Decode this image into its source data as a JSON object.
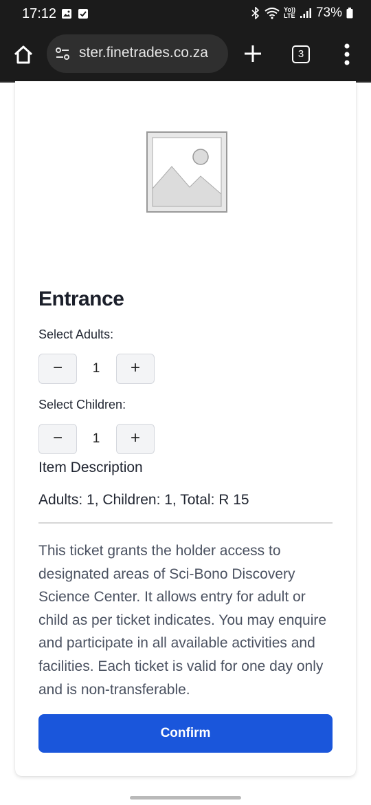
{
  "status_bar": {
    "time": "17:12",
    "battery": "73%",
    "network_label": "Yo))\nLTE",
    "icons": [
      "image-icon",
      "check-icon",
      "bluetooth-icon",
      "wifi-icon",
      "signal-icon",
      "battery-icon"
    ]
  },
  "browser": {
    "url": "ster.finetrades.co.za",
    "tab_count": "3",
    "icons": [
      "home-icon",
      "site-settings-icon",
      "new-tab-icon",
      "tab-switcher-icon",
      "more-menu-icon"
    ]
  },
  "product": {
    "title": "Entrance",
    "image_icon": "image-placeholder-icon",
    "adults": {
      "label": "Select Adults:",
      "value": "1",
      "minus": "−",
      "plus": "+"
    },
    "children": {
      "label": "Select Children:",
      "value": "1",
      "minus": "−",
      "plus": "+"
    },
    "description_title": "Item Description",
    "summary": "Adults: 1, Children: 1, Total: R 15",
    "description": "This ticket grants the holder access to designated areas of Sci-Bono Discovery Science Center. It allows entry for adult or child as per ticket indicates. You may enquire and participate in all available activities and facilities. Each ticket is valid for one day only and is non-transferable.",
    "confirm_label": "Confirm"
  },
  "colors": {
    "primary": "#1a56db",
    "status_bar_bg": "#1b1b1b",
    "title_text": "#1b1f2a",
    "body_text": "#4a5160"
  }
}
